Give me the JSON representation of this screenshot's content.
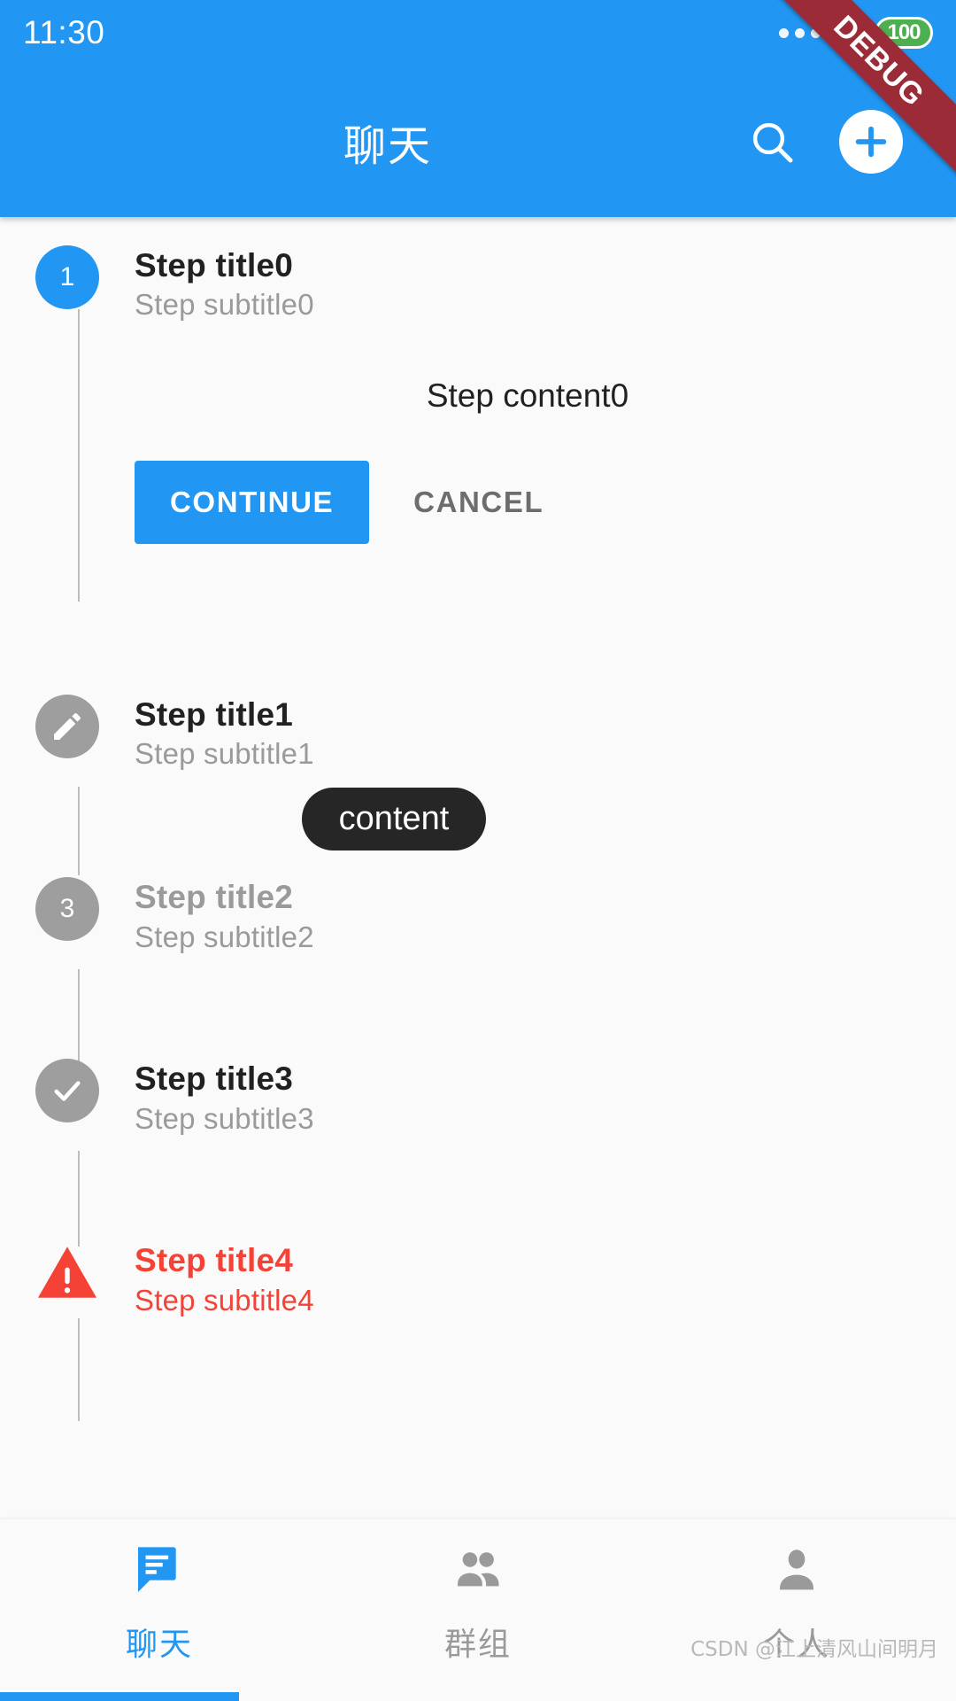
{
  "statusbar": {
    "time": "11:30",
    "battery_level": "100",
    "more_icon": "more-dots-icon",
    "signal_icon": "signal-bars-icon",
    "battery_icon": "battery-icon"
  },
  "debug_ribbon": {
    "label": "DEBUG",
    "color": "#9b2c37"
  },
  "appbar": {
    "title": "聊天",
    "background": "#2196F3",
    "search_icon": "search-icon",
    "add_icon": "plus-icon"
  },
  "stepper": {
    "steps": [
      {
        "marker": "1",
        "marker_type": "number",
        "marker_color": "#2196F3",
        "state": "active",
        "title": "Step title0",
        "subtitle": "Step subtitle0",
        "content": "Step content0",
        "continue_label": "CONTINUE",
        "cancel_label": "CANCEL"
      },
      {
        "marker": "2",
        "marker_type": "edit-icon",
        "marker_color": "#9e9e9e",
        "state": "editing",
        "title": "Step title1",
        "subtitle": "Step subtitle1",
        "content": "content"
      },
      {
        "marker": "3",
        "marker_type": "number",
        "marker_color": "#9e9e9e",
        "state": "disabled",
        "title": "Step title2",
        "subtitle": "Step subtitle2"
      },
      {
        "marker": "4",
        "marker_type": "check-icon",
        "marker_color": "#9e9e9e",
        "state": "complete",
        "title": "Step title3",
        "subtitle": "Step subtitle3"
      },
      {
        "marker": "!",
        "marker_type": "warning-triangle-icon",
        "marker_color": "#F44336",
        "state": "error",
        "title": "Step title4",
        "subtitle": "Step subtitle4"
      }
    ]
  },
  "bottomnav": {
    "active_color": "#2196F3",
    "inactive_color": "#9a9a9a",
    "items": [
      {
        "label": "聊天",
        "icon": "chat-bubble-icon",
        "active": true
      },
      {
        "label": "群组",
        "icon": "group-people-icon",
        "active": false
      },
      {
        "label": "个人",
        "icon": "person-icon",
        "active": false
      }
    ]
  },
  "watermark": {
    "text": "CSDN @江上清风山间明月"
  }
}
